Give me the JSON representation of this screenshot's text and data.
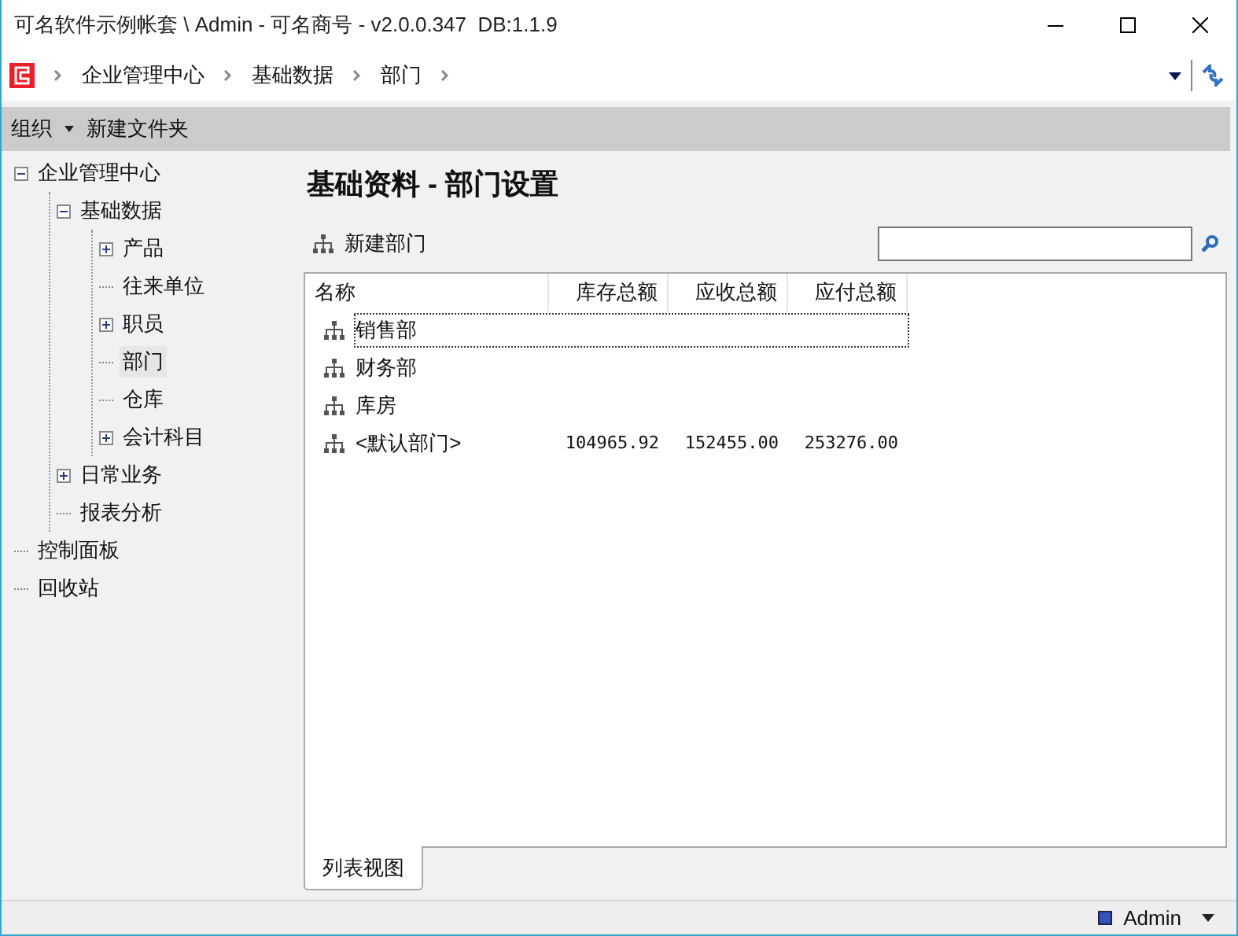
{
  "window": {
    "title": "可名软件示例帐套 \\ Admin - 可名商号 - v2.0.0.347  DB:1.1.9"
  },
  "breadcrumb": [
    "企业管理中心",
    "基础数据",
    "部门"
  ],
  "toolbar": {
    "organize": "组织",
    "new_folder": "新建文件夹"
  },
  "tree": [
    {
      "label": "企业管理中心",
      "expanded": true,
      "selected": false,
      "children": [
        {
          "label": "基础数据",
          "expanded": true,
          "selected": false,
          "children": [
            {
              "label": "产品",
              "expanded": false,
              "selected": false
            },
            {
              "label": "往来单位",
              "selected": false
            },
            {
              "label": "职员",
              "expanded": false,
              "selected": false
            },
            {
              "label": "部门",
              "selected": true
            },
            {
              "label": "仓库",
              "selected": false
            },
            {
              "label": "会计科目",
              "expanded": false,
              "selected": false
            }
          ]
        },
        {
          "label": "日常业务",
          "expanded": false,
          "selected": false
        },
        {
          "label": "报表分析",
          "selected": false
        }
      ]
    },
    {
      "label": "控制面板",
      "selected": false
    },
    {
      "label": "回收站",
      "selected": false
    }
  ],
  "heading": "基础资料 - 部门设置",
  "new_button": "新建部门",
  "table": {
    "columns": [
      "名称",
      "库存总额",
      "应收总额",
      "应付总额"
    ],
    "rows": [
      {
        "selected": true,
        "cells": [
          "销售部",
          "",
          "",
          ""
        ]
      },
      {
        "selected": false,
        "cells": [
          "财务部",
          "",
          "",
          ""
        ]
      },
      {
        "selected": false,
        "cells": [
          "库房",
          "",
          "",
          ""
        ]
      },
      {
        "selected": false,
        "cells": [
          "<默认部门>",
          "104965.92",
          "152455.00",
          "253276.00"
        ]
      }
    ]
  },
  "tabs": [
    {
      "label": "列表视图",
      "selected": true
    }
  ],
  "status_bar": {
    "user": "Admin"
  }
}
